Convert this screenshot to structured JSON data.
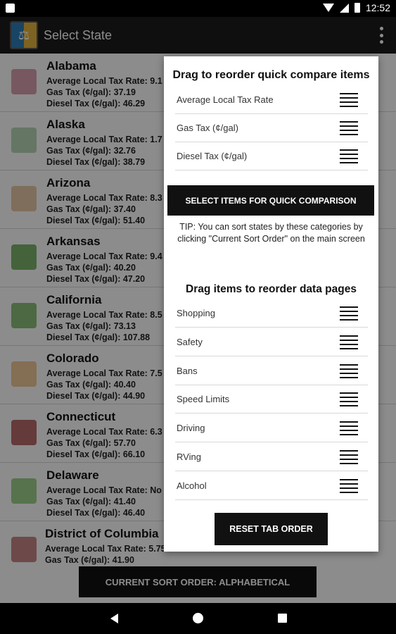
{
  "status_bar": {
    "time": "12:52"
  },
  "app_bar": {
    "title": "Select State"
  },
  "states": [
    {
      "name": "Alabama",
      "local": "Average Local Tax Rate: 9.1",
      "gas": "Gas Tax (¢/gal): 37.19",
      "diesel": "Diesel Tax (¢/gal): 46.29",
      "color": "#d9a0b0"
    },
    {
      "name": "Alaska",
      "local": "Average Local Tax Rate: 1.7",
      "gas": "Gas Tax (¢/gal): 32.76",
      "diesel": "Diesel Tax (¢/gal): 38.79",
      "color": "#b9d7b6"
    },
    {
      "name": "Arizona",
      "local": "Average Local Tax Rate: 8.3",
      "gas": "Gas Tax (¢/gal): 37.40",
      "diesel": "Diesel Tax (¢/gal): 51.40",
      "color": "#e7c9a8"
    },
    {
      "name": "Arkansas",
      "local": "Average Local Tax Rate: 9.4",
      "gas": "Gas Tax (¢/gal): 40.20",
      "diesel": "Diesel Tax (¢/gal): 47.20",
      "color": "#7db46c"
    },
    {
      "name": "California",
      "local": "Average Local Tax Rate: 8.5",
      "gas": "Gas Tax (¢/gal): 73.13",
      "diesel": "Diesel Tax (¢/gal): 107.88",
      "color": "#8cbf7a"
    },
    {
      "name": "Colorado",
      "local": "Average Local Tax Rate: 7.5",
      "gas": "Gas Tax (¢/gal): 40.40",
      "diesel": "Diesel Tax (¢/gal): 44.90",
      "color": "#f0c89a"
    },
    {
      "name": "Connecticut",
      "local": "Average Local Tax Rate: 6.3",
      "gas": "Gas Tax (¢/gal): 57.70",
      "diesel": "Diesel Tax (¢/gal): 66.10",
      "color": "#b86a6a"
    },
    {
      "name": "Delaware",
      "local": "Average Local Tax Rate: No",
      "gas": "Gas Tax (¢/gal): 41.40",
      "diesel": "Diesel Tax (¢/gal): 46.40",
      "color": "#9fd18d"
    },
    {
      "name": "District of Columbia",
      "local": "Average Local Tax Rate: 5.75%",
      "gas": "Gas Tax (¢/gal): 41.90",
      "diesel": "",
      "color": "#c98686"
    }
  ],
  "sort_bar": {
    "label": "CURRENT SORT ORDER: ALPHABETICAL"
  },
  "dialog": {
    "quick_title": "Drag to reorder quick compare items",
    "quick_items": [
      "Average Local Tax Rate",
      "Gas Tax (¢/gal)",
      "Diesel Tax (¢/gal)"
    ],
    "quick_button": "SELECT ITEMS FOR QUICK COMPARISON",
    "tip_line1": "TIP: You can sort states by these categories by",
    "tip_line2": "clicking \"Current Sort Order\" on the main screen",
    "pages_title": "Drag items to reorder data pages",
    "page_items": [
      "Shopping",
      "Safety",
      "Bans",
      "Speed Limits",
      "Driving",
      "RVing",
      "Alcohol"
    ],
    "reset_button": "RESET TAB ORDER"
  },
  "icons": {
    "app_logo": "scales-of-justice-icon",
    "menu": "overflow-menu-icon",
    "drag": "drag-handle-icon",
    "nav": [
      "back-icon",
      "home-icon",
      "recents-icon"
    ]
  }
}
